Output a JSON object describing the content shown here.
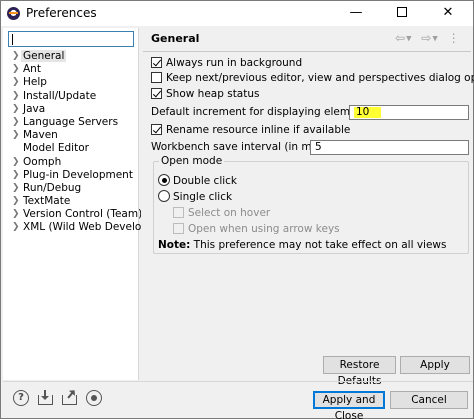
{
  "window": {
    "title": "Preferences"
  },
  "filter": {
    "value": ""
  },
  "tree": [
    {
      "label": "General",
      "selected": true
    },
    {
      "label": "Ant"
    },
    {
      "label": "Help"
    },
    {
      "label": "Install/Update"
    },
    {
      "label": "Java"
    },
    {
      "label": "Language Servers"
    },
    {
      "label": "Maven"
    },
    {
      "label": "Model Editor"
    },
    {
      "label": "Oomph"
    },
    {
      "label": "Plug-in Development"
    },
    {
      "label": "Run/Debug"
    },
    {
      "label": "TextMate"
    },
    {
      "label": "Version Control (Team)"
    },
    {
      "label": "XML (Wild Web Developer)"
    }
  ],
  "page": {
    "title": "General",
    "options": {
      "always_run_background": "Always run in background",
      "keep_next_previous": "Keep next/previous editor, view and perspectives dialog open",
      "show_heap_status": "Show heap status",
      "default_increment_label": "Default increment for displaying elements in UI:",
      "default_increment_value": "10",
      "rename_inline": "Rename resource inline if available",
      "save_interval_label": "Workbench save interval (in minutes):",
      "save_interval_value": "5"
    },
    "open_mode": {
      "label": "Open mode",
      "double_click": "Double click",
      "single_click": "Single click",
      "select_on_hover": "Select on hover",
      "open_arrow_keys": "Open when using arrow keys"
    },
    "note_label": "Note:",
    "note_text": " This preference may not take effect on all views"
  },
  "buttons": {
    "restore_defaults": "Restore Defaults",
    "apply": "Apply",
    "apply_close": "Apply and Close",
    "cancel": "Cancel"
  },
  "colors": {
    "highlight": "#ffff33",
    "focus_blue": "#0078d7"
  }
}
